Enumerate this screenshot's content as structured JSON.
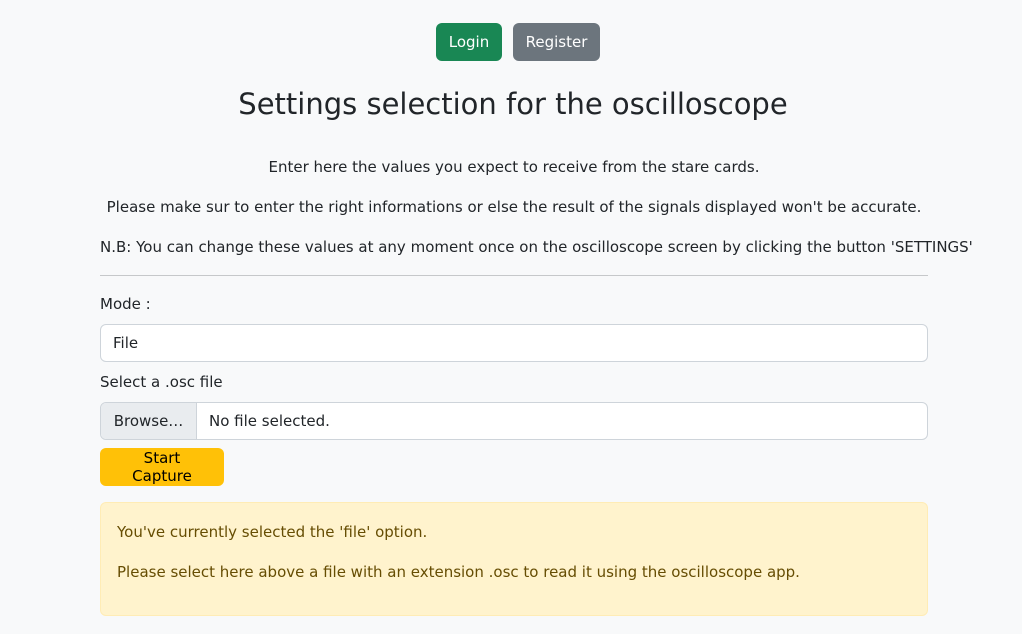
{
  "header": {
    "login_label": "Login",
    "register_label": "Register"
  },
  "page_title": "Settings selection for the oscilloscope",
  "intro": {
    "line1": "Enter here the values you expect to receive from the stare cards.",
    "line2": "Please make sur to enter the right informations or else the result of the signals displayed won't be accurate.",
    "line3": "N.B: You can change these values at any moment once on the oscilloscope screen by clicking the button 'SETTINGS'"
  },
  "form": {
    "mode_label": "Mode :",
    "mode_value": "File",
    "file_label": "Select a .osc file",
    "browse_label": "Browse…",
    "file_status": "No file selected.",
    "capture_label": "Start Capture"
  },
  "alert": {
    "line1": "You've currently selected the 'file' option.",
    "line2": "Please select here above a file with an extension .osc to read it using the oscilloscope app."
  },
  "colors": {
    "login": "#198754",
    "register": "#6c757d",
    "capture": "#ffc107",
    "alert_bg": "#fff3cd",
    "alert_text": "#664d03"
  }
}
